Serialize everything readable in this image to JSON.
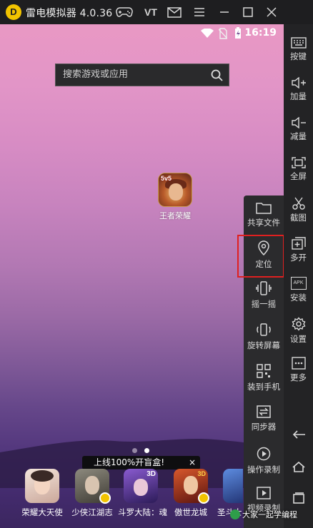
{
  "window": {
    "title": "雷电模拟器 4.0.36",
    "vt_label": "VT",
    "logo_letter": "D"
  },
  "statusbar": {
    "time": "16:19"
  },
  "search": {
    "placeholder": "搜索游戏或应用"
  },
  "desktop_app": {
    "label": "王者荣耀",
    "badge": "5v5"
  },
  "pager": {
    "count": 2,
    "active_index": 1
  },
  "promo": {
    "text": "上线100%开盲盒!",
    "close": "×"
  },
  "dock": {
    "apps": [
      {
        "label": "荣耀大天使",
        "color": "#e9d7cc",
        "download": false
      },
      {
        "label": "少侠江湖志",
        "color": "#6d6a5e",
        "download": true
      },
      {
        "label": "斗罗大陆：魂",
        "color": "#5a3c8c",
        "download": false,
        "tag": "3D"
      },
      {
        "label": "傲世龙城",
        "color": "#b0321e",
        "download": true,
        "tag": "3D"
      },
      {
        "label": "圣斗士",
        "color": "#3a5fb8",
        "download": false
      }
    ]
  },
  "float_panel": {
    "items": [
      {
        "label": "共享文件",
        "icon": "folder-icon"
      },
      {
        "label": "定位",
        "icon": "location-pin-icon",
        "highlighted": true
      },
      {
        "label": "摇一摇",
        "icon": "shake-phone-icon"
      },
      {
        "label": "旋转屏幕",
        "icon": "rotate-screen-icon"
      },
      {
        "label": "装到手机",
        "icon": "qr-code-icon"
      },
      {
        "label": "同步器",
        "icon": "sync-icon"
      },
      {
        "label": "操作录制",
        "icon": "record-icon"
      },
      {
        "label": "视频录制",
        "icon": "video-record-icon"
      }
    ]
  },
  "right_bar": {
    "items": [
      {
        "label": "按键",
        "icon": "keyboard-icon"
      },
      {
        "label": "加量",
        "icon": "volume-up-icon"
      },
      {
        "label": "减量",
        "icon": "volume-down-icon"
      },
      {
        "label": "全屏",
        "icon": "fullscreen-icon"
      },
      {
        "label": "截图",
        "icon": "scissors-icon"
      },
      {
        "label": "多开",
        "icon": "multi-instance-icon"
      },
      {
        "label": "安装",
        "icon": "apk-install-icon",
        "icon_text": "APK"
      },
      {
        "label": "设置",
        "icon": "gear-icon"
      },
      {
        "label": "更多",
        "icon": "more-icon"
      }
    ]
  },
  "watermark": {
    "text": "大家一起学编程"
  },
  "colors": {
    "highlight": "#e02020",
    "accent": "#f2c400"
  }
}
